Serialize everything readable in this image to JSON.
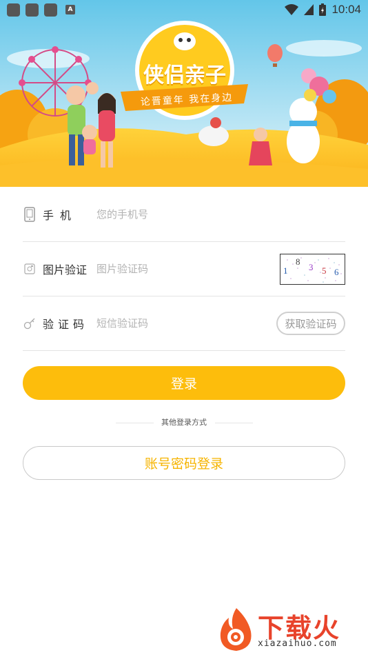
{
  "status_bar": {
    "time": "10:04",
    "notif_letter": "A"
  },
  "banner": {
    "logo_title": "侠侣亲子",
    "logo_slogan": "论晋童年 我在身边"
  },
  "form": {
    "phone": {
      "label": "手机",
      "placeholder": "您的手机号"
    },
    "image_code": {
      "label": "图片验证",
      "placeholder": "图片验证码",
      "captcha_digits": [
        "1",
        "8",
        "3",
        "5",
        "6"
      ]
    },
    "sms_code": {
      "label": "验证码",
      "placeholder": "短信验证码",
      "button": "获取验证码"
    }
  },
  "login_button": "登录",
  "other_login_label": "其他登录方式",
  "account_login_button": "账号密码登录",
  "watermark": {
    "brand": "下载火",
    "url": "xiazaihuo.com"
  },
  "colors": {
    "accent": "#fdbd0c",
    "account_text": "#f6b400"
  }
}
